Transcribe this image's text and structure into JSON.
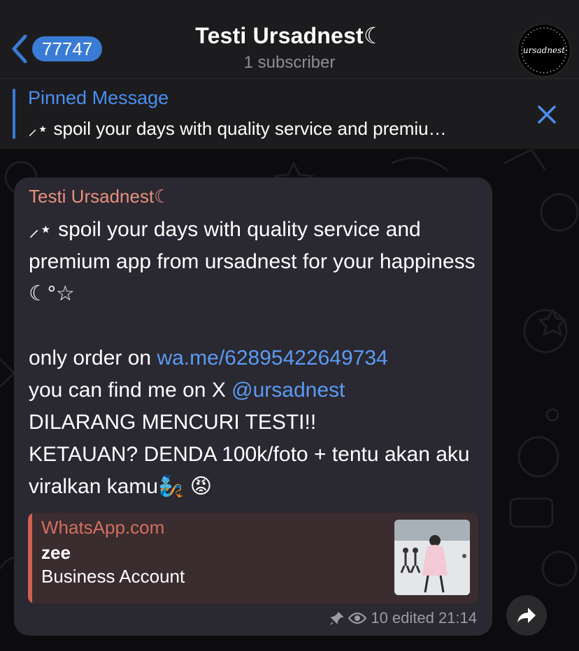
{
  "header": {
    "back_count": "77747",
    "title": "Testi Ursadnest☾",
    "subtitle": "1 subscriber",
    "avatar_text": "ursadnest"
  },
  "pinned": {
    "title": "Pinned Message",
    "text": "⸝⋆ spoil your days with quality service and premiu…"
  },
  "message": {
    "sender": "Testi Ursadnest☾",
    "line1": "⸝⋆ spoil your days with quality service and premium app from ursadnest for your happiness ☾°☆",
    "order_prefix": "only order on ",
    "order_link": "wa.me/62895422649734",
    "find_prefix": "you can find me on X ",
    "find_link": "@ursadnest",
    "warning1": "DILARANG MENCURI TESTI!!",
    "warning2": "KETAUAN? DENDA 100k/foto + tentu akan aku viralkan kamu🧞 😡",
    "views": "10",
    "edited_time": "edited 21:14"
  },
  "link_preview": {
    "site": "WhatsApp.com",
    "name": "zee",
    "description": "Business Account"
  },
  "colors": {
    "accent": "#3a7bd5",
    "link": "#5b9bf4",
    "sender": "#e7917e",
    "preview_accent": "#d05f53"
  }
}
